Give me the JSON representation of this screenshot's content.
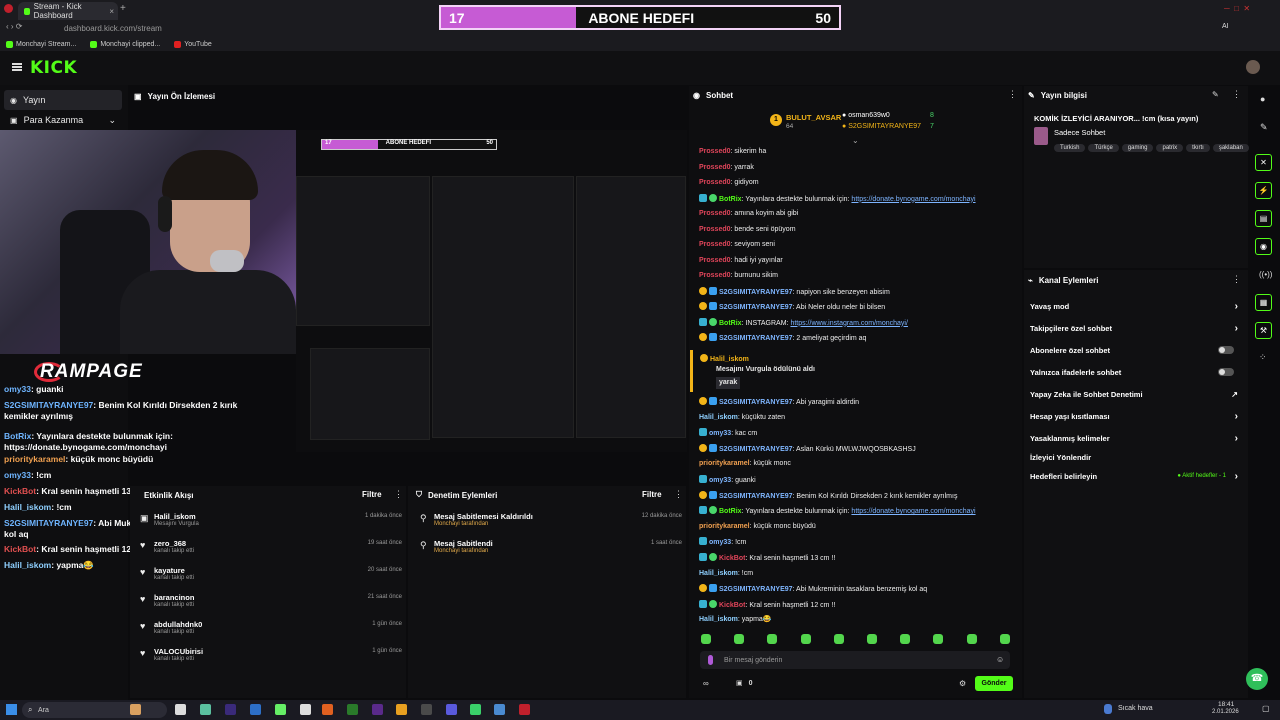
{
  "browser": {
    "tab_title": "Stream - Kick Dashboard",
    "url": "dashboard.kick.com/stream",
    "bookmarks": [
      "Monchayi Stream...",
      "Monchayi clipped...",
      "YouTube"
    ],
    "ai_label": "AI"
  },
  "goal": {
    "current": "17",
    "title": "ABONE HEDEFI",
    "target": "50",
    "progress_fraction": 0.34
  },
  "header": {
    "logo": "KICK"
  },
  "leftnav": {
    "items": [
      "Yayın",
      "Para Kazanma"
    ]
  },
  "preview": {
    "title": "Yayın Ön İzlemesi",
    "mini_goal_current": "17",
    "mini_goal_title": "ABONE HEDEFI",
    "mini_goal_target": "50"
  },
  "overlay": {
    "brand": "RAMPAGE"
  },
  "stream_chat": [
    {
      "user": "omy33",
      "text": "guanki",
      "color": "#6fb5ff"
    },
    {
      "user": "S2GSIMITAYRANYE97",
      "text": "Benim Kol Kırıldı Dirsekden 2 kırık kemikler ayrılmış",
      "color": "#6fb5ff"
    },
    {
      "user": "BotRix",
      "text": "Yayınlara destekte bulunmak için: https://donate.bynogame.com/monchayi",
      "color": "#6fb5ff"
    },
    {
      "user": "prioritykaramel",
      "text": "küçük monc büyüdü",
      "color": "#f0a050"
    },
    {
      "user": "omy33",
      "text": "!cm",
      "color": "#6fb5ff"
    },
    {
      "user": "KickBot",
      "text": "Kral senin haşmetli 13 cm !!",
      "color": "#e05050"
    },
    {
      "user": "Halil_iskom",
      "text": "!cm",
      "color": "#8fd0ff"
    },
    {
      "user": "S2GSIMITAYRANYE97",
      "text": "Abi Mukreminin tasaklara benzemiş kol aq",
      "color": "#6fb5ff"
    },
    {
      "user": "KickBot",
      "text": "Kral senin haşmetli 12 cm !!",
      "color": "#e05050"
    },
    {
      "user": "Halil_iskom",
      "text": "yapma😂",
      "color": "#8fd0ff"
    }
  ],
  "activity": {
    "title": "Etkinlik Akışı",
    "filter_label": "Filtre",
    "rows": [
      {
        "name": "Halil_iskom",
        "sub": "Mesajını Vurgula",
        "time": "1 dakika önce"
      },
      {
        "name": "zero_368",
        "sub": "kanalı takip etti",
        "time": "19 saat önce"
      },
      {
        "name": "kayature",
        "sub": "kanalı takip etti",
        "time": "20 saat önce"
      },
      {
        "name": "barancinon",
        "sub": "kanalı takip etti",
        "time": "21 saat önce"
      },
      {
        "name": "abdullahdnk0",
        "sub": "kanalı takip etti",
        "time": "1 gün önce"
      },
      {
        "name": "VALOCUbirisi",
        "sub": "kanalı takip etti",
        "time": "1 gün önce"
      }
    ]
  },
  "moderation": {
    "title": "Denetim Eylemleri",
    "filter_label": "Filtre",
    "rows": [
      {
        "name": "Mesaj Sabitlemesi Kaldırıldı",
        "sub": "Monchayi tarafından",
        "time": "12 dakika önce"
      },
      {
        "name": "Mesaj Sabitlendi",
        "sub": "Monchayi tarafından",
        "time": "1 saat önce"
      }
    ]
  },
  "chat": {
    "title": "Sohbet",
    "top_gifters": [
      {
        "name": "BULUT_AVSAR",
        "count": "64"
      },
      {
        "name": "osman639w0",
        "count": "8"
      },
      {
        "name": "S2GSIMITAYRANYE97",
        "count": "7"
      }
    ],
    "messages": [
      {
        "user": "Prossed0",
        "text": "sikerim ha",
        "color": "#e0455a",
        "badges": []
      },
      {
        "user": "Prossed0",
        "text": "yarrak",
        "color": "#e0455a",
        "badges": []
      },
      {
        "user": "Prossed0",
        "text": "gidiyom",
        "color": "#e0455a",
        "badges": []
      },
      {
        "user": "BotRix",
        "text": "Yayınlara destekte bulunmak için: ",
        "link": "https://donate.bynogame.com/monchayi",
        "color": "#53fc18",
        "badges": [
          "b-vip",
          "b-green"
        ]
      },
      {
        "user": "Prossed0",
        "text": "amına koyim abi gibi",
        "color": "#e0455a",
        "badges": []
      },
      {
        "user": "Prossed0",
        "text": "bende seni öpüyom",
        "color": "#e0455a",
        "badges": []
      },
      {
        "user": "Prossed0",
        "text": "seviyom seni",
        "color": "#e0455a",
        "badges": []
      },
      {
        "user": "Prossed0",
        "text": "hadi iyi yayınlar",
        "color": "#e0455a",
        "badges": []
      },
      {
        "user": "Prossed0",
        "text": "burnunu sikim",
        "color": "#e0455a",
        "badges": []
      },
      {
        "user": "S2GSIMITAYRANYE97",
        "text": "napiyon sike benzeyen abisim",
        "color": "#7fb6ff",
        "badges": [
          "b-gold",
          "b-blue"
        ]
      },
      {
        "user": "S2GSIMITAYRANYE97",
        "text": "Abi Neler oldu neler bi bilsen",
        "color": "#7fb6ff",
        "badges": [
          "b-gold",
          "b-blue"
        ]
      },
      {
        "user": "BotRix",
        "text": "INSTAGRAM: ",
        "link": "https://www.instagram.com/monchayi/",
        "color": "#53fc18",
        "badges": [
          "b-vip",
          "b-green"
        ]
      },
      {
        "user": "S2GSIMITAYRANYE97",
        "text": "2 ameliyat geçirdim aq",
        "color": "#7fb6ff",
        "badges": [
          "b-gold",
          "b-blue"
        ]
      }
    ],
    "highlight": {
      "user": "Halil_iskom",
      "text": "Mesajını Vurgula ödülünü aldı",
      "reply": "yarak"
    },
    "messages2": [
      {
        "user": "S2GSIMITAYRANYE97",
        "text": "Abi yaragimi aldirdin",
        "color": "#7fb6ff",
        "badges": [
          "b-gold",
          "b-blue"
        ]
      },
      {
        "user": "Halil_iskom",
        "text": "küçüktu zaten",
        "color": "#8fd0ff",
        "badges": []
      },
      {
        "user": "omy33",
        "text": "kac cm",
        "color": "#7fb6ff",
        "badges": [
          "b-vip"
        ]
      },
      {
        "user": "S2GSIMITAYRANYE97",
        "text": "Aslan Kürkü MWLWJWQOSBKASHSJ",
        "color": "#7fb6ff",
        "badges": [
          "b-gold",
          "b-blue"
        ]
      },
      {
        "user": "prioritykaramel",
        "text": "küçük monc",
        "color": "#f0a050",
        "badges": []
      },
      {
        "user": "omy33",
        "text": "guanki",
        "color": "#7fb6ff",
        "badges": [
          "b-vip"
        ]
      },
      {
        "user": "S2GSIMITAYRANYE97",
        "text": "Benim Kol Kırıldı Dirsekden 2 kırık kemikler ayrılmış",
        "color": "#7fb6ff",
        "badges": [
          "b-gold",
          "b-blue"
        ]
      },
      {
        "user": "BotRix",
        "text": "Yayınlara destekte bulunmak için: ",
        "link": "https://donate.bynogame.com/monchayi",
        "color": "#53fc18",
        "badges": [
          "b-vip",
          "b-green"
        ]
      },
      {
        "user": "prioritykaramel",
        "text": "küçük monc büyüdü",
        "color": "#f0a050",
        "badges": []
      },
      {
        "user": "omy33",
        "text": "!cm",
        "color": "#7fb6ff",
        "badges": [
          "b-vip"
        ]
      },
      {
        "user": "KickBot",
        "text": "Kral senin haşmetli 13 cm !!",
        "color": "#e0455a",
        "badges": [
          "b-vip",
          "b-green"
        ]
      },
      {
        "user": "Halil_iskom",
        "text": "!cm",
        "color": "#8fd0ff",
        "badges": []
      },
      {
        "user": "S2GSIMITAYRANYE97",
        "text": "Abi Mukreminin tasaklara benzemiş kol aq",
        "color": "#7fb6ff",
        "badges": [
          "b-gold",
          "b-blue"
        ]
      },
      {
        "user": "KickBot",
        "text": "Kral senin haşmetli 12 cm !!",
        "color": "#e0455a",
        "badges": [
          "b-vip",
          "b-green"
        ]
      },
      {
        "user": "Halil_iskom",
        "text": "yapma😂",
        "color": "#8fd0ff",
        "badges": []
      }
    ],
    "input_placeholder": "Bir mesaj gönderin",
    "points": "0",
    "send_label": "Gönder"
  },
  "info": {
    "title": "Yayın bilgisi",
    "stream_title": "KOMİK İZLEYİCİ ARANIYOR... !cm (kısa yayın)",
    "category": "Sadece Sohbet",
    "tags": [
      "Turkish",
      "Türkçe",
      "gaming",
      "patrix",
      "tkırtı",
      "şaklaban"
    ]
  },
  "actions": {
    "title": "Kanal Eylemleri",
    "items": [
      {
        "label": "Yavaş mod",
        "kind": "chevron"
      },
      {
        "label": "Takipçilere özel sohbet",
        "kind": "chevron"
      },
      {
        "label": "Abonelere özel sohbet",
        "kind": "toggle"
      },
      {
        "label": "Yalnızca ifadelerle sohbet",
        "kind": "toggle"
      },
      {
        "label": "Yapay Zeka ile Sohbet Denetimi",
        "kind": "external"
      },
      {
        "label": "Hesap yaşı kısıtlaması",
        "kind": "chevron"
      },
      {
        "label": "Yasaklanmış kelimeler",
        "kind": "chevron"
      },
      {
        "label": "İzleyici Yönlendir",
        "kind": "none"
      },
      {
        "label": "Hedefleri belirleyin",
        "kind": "chevron",
        "extra": "Aktif hedefler - 1"
      }
    ]
  },
  "taskbar": {
    "search_placeholder": "Ara",
    "weather": "Sıcak hava",
    "time": "18:41",
    "date": "2.01.2026"
  },
  "colors": {
    "accent": "#53fc18",
    "goal_fill": "#c65bd4"
  }
}
